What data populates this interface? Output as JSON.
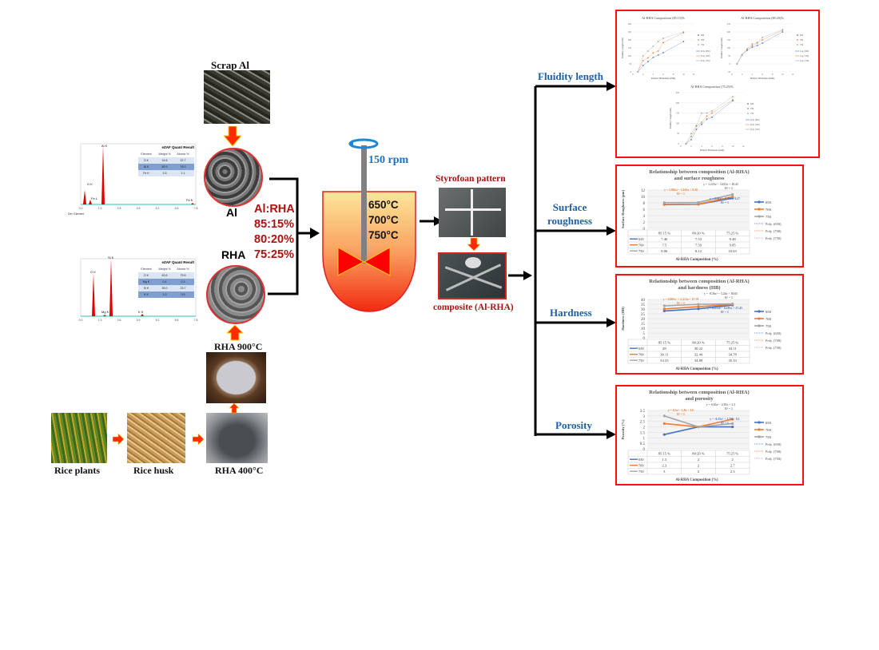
{
  "materials": {
    "scrap_al": "Scrap Al",
    "al": "Al",
    "rha": "RHA",
    "rha_900": "RHA  900°C",
    "rha_400": "RHA  400°C",
    "rice_plants": "Rice plants",
    "rice_husk": "Rice husk"
  },
  "ratio": {
    "title": "Al:RHA",
    "values": [
      "85:15%",
      "80:20%",
      "75:25%"
    ]
  },
  "stir": {
    "speed": "150 rpm",
    "temps": [
      "650°C",
      "700°C",
      "750°C"
    ]
  },
  "pattern": {
    "styrofoam": "Styrofoan pattern",
    "composite": "composite (Al-RHA)"
  },
  "branches": {
    "fluidity": "Fluidity  length",
    "roughness_1": "Surface",
    "roughness_2": "roughness",
    "hardness": "Hardness",
    "porosity": "Porosity"
  },
  "colors": {
    "s650": "#4472c4",
    "s700": "#ed7d31",
    "s750": "#a5a5a5",
    "frame": "#ff1010",
    "arrow_red": "#ff2a00",
    "label_blue": "#1f5fa8",
    "label_red": "#b01010"
  },
  "eds_al": {
    "title": "eZAF Quant Result",
    "headers": [
      "Element",
      "Weight %",
      "Atomic %"
    ],
    "rows": [
      [
        "O K",
        "14.6",
        "22.7"
      ],
      [
        "Al K",
        "82.9",
        "76.3"
      ],
      [
        "Fe K",
        "2.5",
        "1.1"
      ]
    ],
    "peaks": [
      "Al K",
      "O K",
      "Fe L",
      "Fe K"
    ],
    "x_ticks": [
      "0.0",
      "1.3",
      "2.6",
      "3.9",
      "5.2",
      "6.5",
      "7.8"
    ],
    "footer": "Det: Element"
  },
  "eds_rha": {
    "title": "eZAF Quant Result",
    "headers": [
      "Element",
      "Weight %",
      "Atomic %"
    ],
    "rows": [
      [
        "O K",
        "63.6",
        "75.6"
      ],
      [
        "Mg K",
        "0.4",
        "0.3"
      ],
      [
        "Si K",
        "35.0",
        "23.7"
      ],
      [
        "K K",
        "1.0",
        "0.5"
      ]
    ],
    "peaks": [
      "Si K",
      "O K",
      "Mg K",
      "K K"
    ],
    "x_ticks": [
      "0.0",
      "1.3",
      "2.6",
      "3.9",
      "5.2",
      "6.5",
      "7.8"
    ]
  },
  "chart_data": [
    {
      "type": "scatter",
      "title": "Al-RHA Composition (85:15)%",
      "xlabel": "Pattern Thickness (mm)",
      "ylabel": "Fluidity Length (mm)",
      "xlim": [
        0,
        12
      ],
      "ylim": [
        0,
        300
      ],
      "yticks": [
        0,
        50,
        100,
        150,
        200,
        250,
        300
      ],
      "xticks": [
        0,
        2,
        4,
        6,
        8,
        10,
        12
      ],
      "x": [
        1,
        2,
        3,
        4,
        5,
        6,
        10
      ],
      "series": [
        {
          "name": "650",
          "values": [
            0,
            40,
            65,
            90,
            105,
            120,
            190
          ]
        },
        {
          "name": "700",
          "values": [
            0,
            70,
            88,
            118,
            130,
            183,
            245
          ]
        },
        {
          "name": "750",
          "values": [
            0,
            100,
            130,
            160,
            190,
            210,
            250
          ]
        }
      ],
      "trend_names": [
        "Poly. (650)",
        "Poly. (700)",
        "Poly. (750)"
      ]
    },
    {
      "type": "scatter",
      "title": "Al-RHA Composition (80:20)%",
      "xlabel": "Pattern Thickness (mm)",
      "ylabel": "Fluidity Length (mm)",
      "xlim": [
        0,
        12
      ],
      "ylim": [
        -50,
        250
      ],
      "yticks": [
        -50,
        0,
        50,
        100,
        150,
        200,
        250
      ],
      "xticks": [
        0,
        2,
        4,
        6,
        8,
        10,
        12
      ],
      "x": [
        1,
        2,
        3,
        4,
        5,
        6,
        10
      ],
      "series": [
        {
          "name": "650",
          "values": [
            0,
            55,
            85,
            105,
            115,
            130,
            200
          ]
        },
        {
          "name": "700",
          "values": [
            0,
            57,
            90,
            115,
            130,
            150,
            210
          ]
        },
        {
          "name": "750",
          "values": [
            0,
            58,
            95,
            125,
            135,
            165,
            215
          ]
        }
      ],
      "trend_names": [
        "Log. (650)",
        "Log. (700)",
        "Log. (750)"
      ]
    },
    {
      "type": "scatter",
      "title": "Al-RHA Composition (75:25)%",
      "xlabel": "Pattern Thickness (mm)",
      "ylabel": "Fluidity Length (mm)",
      "xlim": [
        0,
        12
      ],
      "ylim": [
        0,
        250
      ],
      "yticks": [
        0,
        50,
        100,
        150,
        200,
        250
      ],
      "xticks": [
        0,
        2,
        4,
        6,
        8,
        10,
        12
      ],
      "x": [
        1,
        2,
        3,
        4,
        5,
        6,
        10
      ],
      "series": [
        {
          "name": "650",
          "values": [
            0,
            20,
            70,
            95,
            120,
            130,
            210
          ]
        },
        {
          "name": "700",
          "values": [
            0,
            35,
            85,
            105,
            135,
            150,
            215
          ]
        },
        {
          "name": "750",
          "values": [
            0,
            50,
            90,
            150,
            150,
            160,
            230
          ]
        }
      ],
      "trend_names": [
        "Poly. (650)",
        "Poly. (700)",
        "Poly. (750)"
      ]
    },
    {
      "type": "line",
      "title": [
        "Relationship between composition (Al-RHA)",
        "and surface roughness"
      ],
      "xlabel": "Al-RHA Composition (%)",
      "ylabel": "Surface Roughness (μm)",
      "ylim": [
        0,
        12
      ],
      "yticks": [
        0,
        2,
        4,
        6,
        8,
        10,
        12
      ],
      "categories": [
        "85:15 %",
        "80:20 %",
        "75:25 %"
      ],
      "series": [
        {
          "name": "650",
          "values": [
            7.46,
            7.53,
            9.48
          ]
        },
        {
          "name": "700",
          "values": [
            7.5,
            7.59,
            9.85
          ]
        },
        {
          "name": "750",
          "values": [
            8.06,
            8.12,
            10.63
          ]
        }
      ],
      "trend_names": [
        "Poly. (650)",
        "Poly. (700)",
        "Poly. (750)"
      ],
      "equations": [
        {
          "text": "y = 1.225x² - 3.615x + 10.45",
          "text2": "R² = 1",
          "series": "750"
        },
        {
          "text": "y = 1.085x² - 3.165x + 9.58",
          "text2": "R² = 1",
          "series": "700"
        },
        {
          "text": "y = 0.94x² - 2.75x + 9.27",
          "text2": "R² = 1",
          "series": "650"
        }
      ]
    },
    {
      "type": "line",
      "title": [
        "Relationship between composition (Al-RHA)",
        "and hardness       (HB)"
      ],
      "xlabel": "Al-RHA Composition (%)",
      "ylabel": "Hardness (HB)",
      "ylim": [
        0,
        40
      ],
      "yticks": [
        0,
        5,
        10,
        15,
        20,
        25,
        30,
        35,
        40
      ],
      "categories": [
        "85:15 %",
        "80:20 %",
        "75:25 %"
      ],
      "series": [
        {
          "name": "650",
          "values": [
            28,
            30.22,
            34.11
          ]
        },
        {
          "name": "700",
          "values": [
            30.11,
            32.44,
            34.78
          ]
        },
        {
          "name": "750",
          "values": [
            33.33,
            34.89,
            35.33
          ]
        }
      ],
      "trend_names": [
        "Poly. (650)",
        "Poly. (700)",
        "Poly. (750)"
      ],
      "equations": [
        {
          "text": "y = -0.56x² + 3.24x + 30.65",
          "text2": "R² = 1",
          "series": "750"
        },
        {
          "text": "y = 0.005x² + 2.315x + 27.79",
          "text2": "R² = 1",
          "series": "700"
        },
        {
          "text": "y = 0.835x² - 0.285x + 27.45",
          "text2": "R² = 1",
          "series": "650"
        }
      ]
    },
    {
      "type": "line",
      "title": [
        "Relationship between composition (Al-RHA)",
        "and porosity"
      ],
      "xlabel": "Al-RHA Composition (%)",
      "ylabel": "Porosity (%)",
      "ylim": [
        0,
        3.5
      ],
      "yticks": [
        0,
        0.5,
        1,
        1.5,
        2,
        2.5,
        3,
        3.5
      ],
      "categories": [
        "85:15 %",
        "80:20 %",
        "75:25 %"
      ],
      "series": [
        {
          "name": "650",
          "values": [
            1.3,
            2,
            2
          ]
        },
        {
          "name": "700",
          "values": [
            2.3,
            2,
            2.7
          ]
        },
        {
          "name": "750",
          "values": [
            3,
            2,
            2.3
          ]
        }
      ],
      "trend_names": [
        "Poly. (650)",
        "Poly. (700)",
        "Poly. (750)"
      ],
      "equations": [
        {
          "text": "y = 0.65x² - 2.95x + 5.3",
          "text2": "R² = 1",
          "series": "750"
        },
        {
          "text": "y = 0.5x² - 1.8x + 3.6",
          "text2": "R² = 1",
          "series": "700"
        },
        {
          "text": "y = -0.35x² + 1.75x - 0.1",
          "text2": "R² = 1",
          "series": "650"
        }
      ]
    }
  ]
}
